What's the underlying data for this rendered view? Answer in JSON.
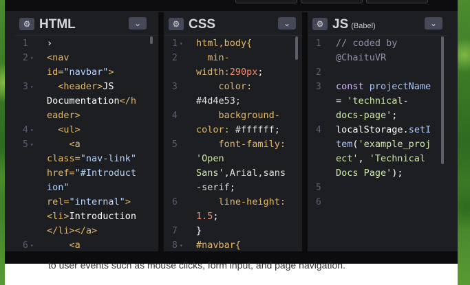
{
  "panes": {
    "html": {
      "title": "HTML",
      "subtitle": "",
      "line_numbers": [
        "1",
        "2",
        "3",
        "4",
        "5",
        "6"
      ],
      "fold_marks": [
        "",
        "▾",
        "▾",
        "▾",
        "▾",
        "▾"
      ]
    },
    "css": {
      "title": "CSS",
      "subtitle": "",
      "line_numbers": [
        "1",
        "2",
        "3",
        "4",
        "5",
        "6",
        "7",
        "8"
      ],
      "fold_marks": [
        "▾",
        "",
        "",
        "",
        "",
        "",
        "",
        "▾"
      ]
    },
    "js": {
      "title": "JS",
      "subtitle": "(Babel)",
      "line_numbers": [
        "1",
        "2",
        "3",
        "4",
        "5",
        "6"
      ]
    }
  },
  "html_code": [
    [
      {
        "t": "›",
        "c": ""
      }
    ],
    [
      {
        "t": "<nav",
        "c": "k-tag"
      }
    ],
    [
      {
        "t": "id=",
        "c": "k-attr"
      },
      {
        "t": "\"navbar\"",
        "c": "k-val"
      },
      {
        "t": ">",
        "c": "k-tag"
      }
    ],
    [
      {
        "t": "  <header>",
        "c": "k-tag"
      },
      {
        "t": "JS",
        "c": ""
      }
    ],
    [
      {
        "t": "Documentation",
        "c": ""
      },
      {
        "t": "</h",
        "c": "k-tag"
      }
    ],
    [
      {
        "t": "eader>",
        "c": "k-tag"
      }
    ],
    [
      {
        "t": "  <ul>",
        "c": "k-tag"
      }
    ],
    [
      {
        "t": "    <a",
        "c": "k-tag"
      }
    ],
    [
      {
        "t": "class=",
        "c": "k-attr"
      },
      {
        "t": "\"nav-link\"",
        "c": "k-val"
      }
    ],
    [
      {
        "t": "href=",
        "c": "k-attr"
      },
      {
        "t": "\"#Introduct",
        "c": "k-val"
      }
    ],
    [
      {
        "t": "ion\"",
        "c": "k-val"
      }
    ],
    [
      {
        "t": "rel=",
        "c": "k-attr"
      },
      {
        "t": "\"internal\"",
        "c": "k-val"
      },
      {
        "t": ">",
        "c": "k-tag"
      }
    ],
    [
      {
        "t": "<li>",
        "c": "k-tag"
      },
      {
        "t": "Introduction",
        "c": ""
      }
    ],
    [
      {
        "t": "</li></a>",
        "c": "k-tag"
      }
    ],
    [
      {
        "t": "    <a",
        "c": "k-tag"
      }
    ]
  ],
  "css_code": [
    [
      {
        "t": "html,body{",
        "c": "k-sel"
      }
    ],
    [
      {
        "t": "  min-",
        "c": "k-prop"
      }
    ],
    [
      {
        "t": "width:",
        "c": "k-prop"
      },
      {
        "t": "290px",
        "c": "k-num"
      },
      {
        "t": ";",
        "c": ""
      }
    ],
    [
      {
        "t": "    color:",
        "c": "k-prop"
      }
    ],
    [
      {
        "t": "#4d4e53;",
        "c": "k-cval"
      }
    ],
    [
      {
        "t": "    background-",
        "c": "k-prop"
      }
    ],
    [
      {
        "t": "color: ",
        "c": "k-prop"
      },
      {
        "t": "#ffffff;",
        "c": "k-cval"
      }
    ],
    [
      {
        "t": "    font-family:",
        "c": "k-prop"
      }
    ],
    [
      {
        "t": "'Open",
        "c": "k-str"
      }
    ],
    [
      {
        "t": "Sans'",
        "c": "k-str"
      },
      {
        "t": ",Arial,sans",
        "c": "k-cval"
      }
    ],
    [
      {
        "t": "-serif;",
        "c": "k-cval"
      }
    ],
    [
      {
        "t": "    line-height:",
        "c": "k-prop"
      }
    ],
    [
      {
        "t": "1.5",
        "c": "k-num"
      },
      {
        "t": ";",
        "c": ""
      }
    ],
    [
      {
        "t": "}",
        "c": ""
      }
    ],
    [
      {
        "t": "#navbar{",
        "c": "k-sel"
      }
    ]
  ],
  "js_code": [
    [
      {
        "t": "// coded by",
        "c": "k-cm"
      }
    ],
    [
      {
        "t": "@ChaituVR",
        "c": "k-cm"
      }
    ],
    [
      {
        "t": "",
        "c": ""
      }
    ],
    [
      {
        "t": "const ",
        "c": "k-kw"
      },
      {
        "t": "projectName",
        "c": "k-var"
      }
    ],
    [
      {
        "t": "= ",
        "c": ""
      },
      {
        "t": "'technical-",
        "c": "k-str"
      }
    ],
    [
      {
        "t": "docs-page'",
        "c": "k-str"
      },
      {
        "t": ";",
        "c": ""
      }
    ],
    [
      {
        "t": "localStorage",
        "c": ""
      },
      {
        "t": ".",
        "c": ""
      },
      {
        "t": "setI",
        "c": "k-var"
      }
    ],
    [
      {
        "t": "tem",
        "c": "k-var"
      },
      {
        "t": "(",
        "c": ""
      },
      {
        "t": "'example_proj",
        "c": "k-str"
      }
    ],
    [
      {
        "t": "ect'",
        "c": "k-str"
      },
      {
        "t": ", ",
        "c": ""
      },
      {
        "t": "'Technical",
        "c": "k-str"
      }
    ],
    [
      {
        "t": "Docs Page'",
        "c": "k-str"
      },
      {
        "t": ");",
        "c": ""
      }
    ]
  ],
  "page": {
    "text": "to user events such as mouse clicks, form input, and page navigation."
  },
  "colors": {
    "editor_bg": "#1d1e22",
    "tag": "#e3b869",
    "string": "#cfe9a6",
    "number": "#f78c6c",
    "comment": "#8e93a6"
  },
  "icons": {
    "settings": "gear-icon",
    "collapse": "chevron-down-icon"
  }
}
